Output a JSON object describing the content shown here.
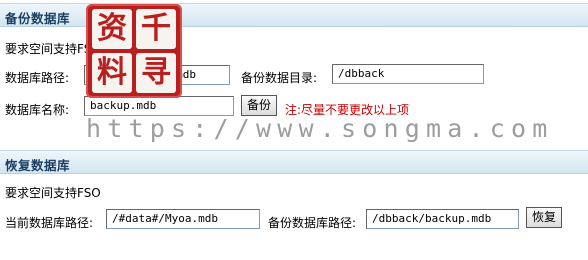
{
  "backup": {
    "title": "备份数据库",
    "requirement": "要求空间支持FSO",
    "db_path_label": "数据库路径:",
    "db_path_value": "/#data#/Myoa.mdb",
    "backup_dir_label": "备份数据目录:",
    "backup_dir_value": "/dbback",
    "db_name_label": "数据库名称:",
    "db_name_value": "backup.mdb",
    "button_label": "备份",
    "note": "注:尽量不要更改以上项"
  },
  "restore": {
    "title": "恢复数据库",
    "requirement": "要求空间支持FSO",
    "current_path_label": "当前数据库路径:",
    "current_path_value": "/#data#/Myoa.mdb",
    "backup_path_label": "备份数据库路径:",
    "backup_path_value": "/dbback/backup.mdb",
    "button_label": "恢复"
  },
  "watermark": {
    "url": "https://www.songma.com",
    "seal_chars": [
      "资",
      "千",
      "料",
      "寻"
    ]
  },
  "colors": {
    "header_text": "#1b3f63",
    "note": "#cc0000",
    "seal": "#b8201f"
  }
}
